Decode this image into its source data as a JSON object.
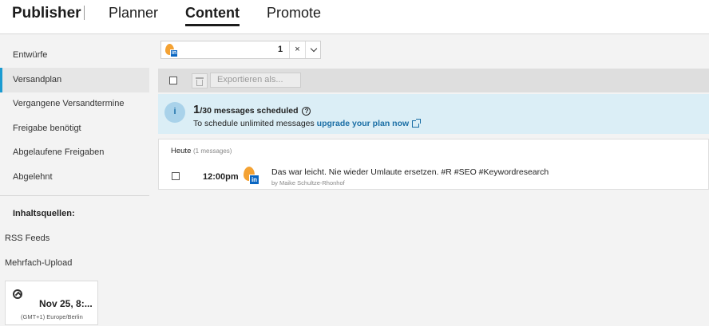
{
  "nav": {
    "brand": "Publisher",
    "tabs": [
      {
        "label": "Planner",
        "active": false
      },
      {
        "label": "Content",
        "active": true
      },
      {
        "label": "Promote",
        "active": false
      }
    ]
  },
  "sidebar": {
    "items": [
      {
        "label": "Entwürfe",
        "active": false
      },
      {
        "label": "Versandplan",
        "active": true
      },
      {
        "label": "Vergangene Versandtermine",
        "active": false
      },
      {
        "label": "Freigabe benötigt",
        "active": false
      },
      {
        "label": "Abgelaufene Freigaben",
        "active": false
      },
      {
        "label": "Abgelehnt",
        "active": false
      }
    ],
    "sources_heading": "Inhaltsquellen:",
    "links": [
      "RSS Feeds",
      "Mehrfach-Upload"
    ],
    "timezone": {
      "datetime": "Nov 25, 8:...",
      "zone": "(GMT+1) Europe/Berlin",
      "icon": "globe-icon"
    }
  },
  "filter": {
    "count": "1",
    "clear": "×",
    "profile_icon": "linkedin-profile-avatar"
  },
  "toolbar": {
    "export_label": "Exportieren als..."
  },
  "banner": {
    "scheduled": "1",
    "limit_text": "/30 messages scheduled",
    "help": "?",
    "upgrade_prefix": "To schedule unlimited messages ",
    "upgrade_link": "upgrade your plan now"
  },
  "messages": {
    "day_label": "Heute",
    "day_count": "(1 messages)",
    "items": [
      {
        "time": "12:00pm",
        "text": "Das war leicht. Nie wieder Umlaute ersetzen. #R #SEO #Keywordresearch",
        "author": "by Maike Schultze-Rhonhof"
      }
    ]
  },
  "colors": {
    "accent": "#1b9bd1",
    "banner_bg": "#dbeef6",
    "link": "#1a6ea5",
    "linkedin": "#0a66c2"
  }
}
